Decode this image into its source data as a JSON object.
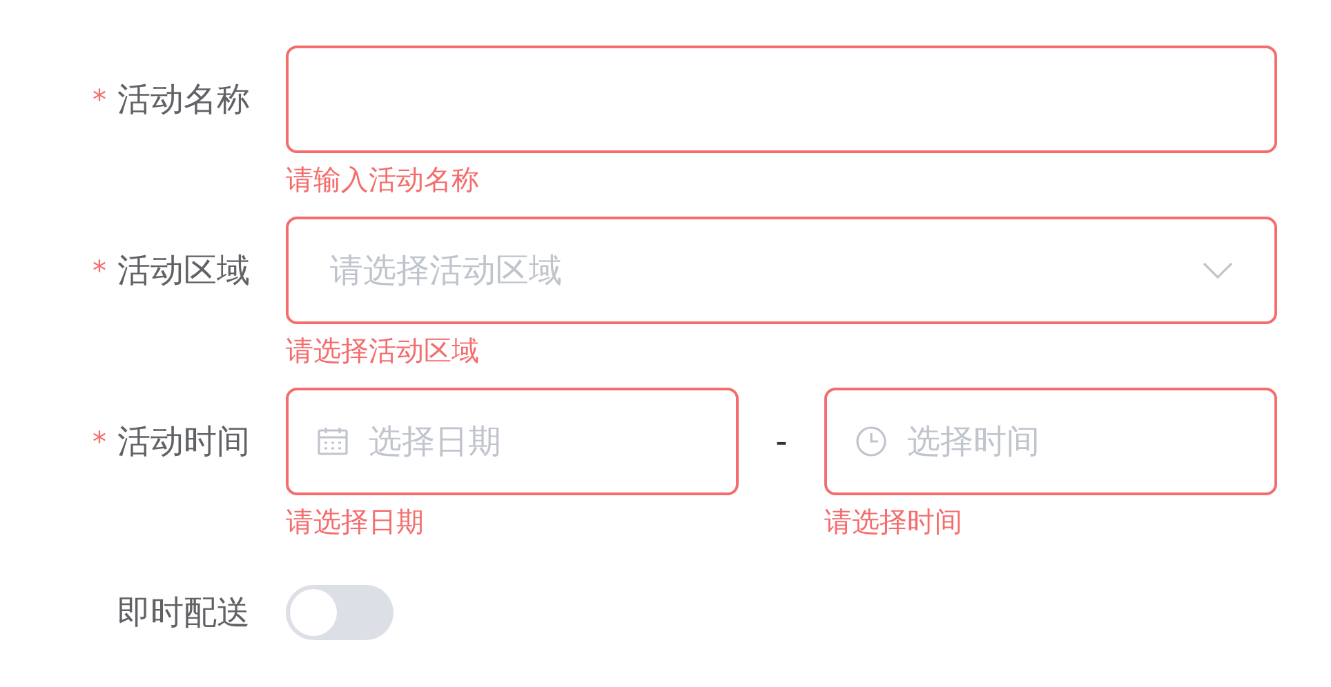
{
  "form": {
    "fields": [
      {
        "kind": "text",
        "mark": "*",
        "label": "活动名称",
        "error": "请输入活动名称"
      },
      {
        "kind": "select",
        "mark": "*",
        "label": "活动区域",
        "placeholder": "请选择活动区域",
        "error": "请选择活动区域"
      },
      {
        "kind": "datetime",
        "mark": "*",
        "label": "活动时间",
        "date": {
          "placeholder": "选择日期",
          "error": "请选择日期"
        },
        "separator": "-",
        "time": {
          "placeholder": "选择时间",
          "error": "请选择时间"
        }
      },
      {
        "kind": "switch",
        "label": "即时配送",
        "on": false
      }
    ]
  }
}
